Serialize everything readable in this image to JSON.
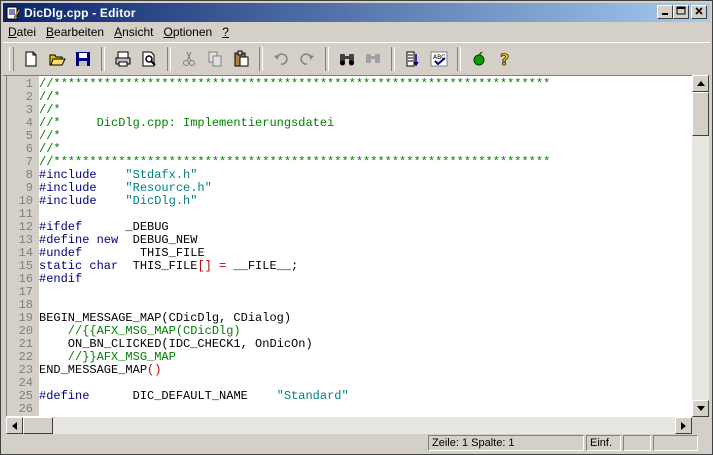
{
  "window": {
    "title": "DicDlg.cpp - Editor",
    "title_gradient": [
      "#0a246a",
      "#a6caf0"
    ],
    "controls": [
      "minimize",
      "maximize",
      "close"
    ]
  },
  "menu": [
    {
      "label": "Datei"
    },
    {
      "label": "Bearbeiten"
    },
    {
      "label": "Ansicht"
    },
    {
      "label": "Optionen"
    },
    {
      "label": "?"
    }
  ],
  "toolbar": [
    {
      "name": "new-file-icon",
      "enabled": true
    },
    {
      "name": "open-folder-icon",
      "enabled": true
    },
    {
      "name": "save-icon",
      "enabled": true
    },
    {
      "sep": true
    },
    {
      "name": "print-icon",
      "enabled": true
    },
    {
      "name": "print-preview-icon",
      "enabled": true
    },
    {
      "sep": true
    },
    {
      "name": "cut-icon",
      "enabled": false
    },
    {
      "name": "copy-icon",
      "enabled": false
    },
    {
      "name": "paste-icon",
      "enabled": true
    },
    {
      "sep": true
    },
    {
      "name": "undo-icon",
      "enabled": false
    },
    {
      "name": "redo-icon",
      "enabled": false
    },
    {
      "sep": true
    },
    {
      "name": "find-icon",
      "enabled": true
    },
    {
      "name": "replace-icon",
      "enabled": false
    },
    {
      "sep": true
    },
    {
      "name": "indent-icon",
      "enabled": true
    },
    {
      "name": "spellcheck-icon",
      "enabled": true
    },
    {
      "sep": true
    },
    {
      "name": "run-icon",
      "enabled": true
    },
    {
      "name": "help-icon",
      "enabled": true
    }
  ],
  "editor": {
    "lines": [
      {
        "n": "1",
        "segs": [
          [
            "g",
            "//*********************************************************************"
          ]
        ]
      },
      {
        "n": "2",
        "segs": [
          [
            "g",
            "//*"
          ]
        ]
      },
      {
        "n": "3",
        "segs": [
          [
            "g",
            "//*"
          ]
        ]
      },
      {
        "n": "4",
        "segs": [
          [
            "g",
            "//*     DicDlg.cpp: Implementierungsdatei"
          ]
        ]
      },
      {
        "n": "5",
        "segs": [
          [
            "g",
            "//*"
          ]
        ]
      },
      {
        "n": "6",
        "segs": [
          [
            "g",
            "//*"
          ]
        ]
      },
      {
        "n": "7",
        "segs": [
          [
            "g",
            "//*********************************************************************"
          ]
        ]
      },
      {
        "n": "8",
        "segs": [
          [
            "b",
            "#include"
          ],
          [
            "k",
            "    "
          ],
          [
            "t",
            "\"Stdafx.h\""
          ]
        ]
      },
      {
        "n": "9",
        "segs": [
          [
            "b",
            "#include"
          ],
          [
            "k",
            "    "
          ],
          [
            "t",
            "\"Resource.h\""
          ]
        ]
      },
      {
        "n": "10",
        "segs": [
          [
            "b",
            "#include"
          ],
          [
            "k",
            "    "
          ],
          [
            "t",
            "\"DicDlg.h\""
          ]
        ]
      },
      {
        "n": "11",
        "segs": [
          [
            "k",
            ""
          ]
        ]
      },
      {
        "n": "12",
        "segs": [
          [
            "b",
            "#ifdef"
          ],
          [
            "k",
            "      _DEBUG"
          ]
        ]
      },
      {
        "n": "13",
        "segs": [
          [
            "b",
            "#define new"
          ],
          [
            "k",
            "  DEBUG_NEW"
          ]
        ]
      },
      {
        "n": "14",
        "segs": [
          [
            "b",
            "#undef"
          ],
          [
            "k",
            "        THIS_FILE"
          ]
        ]
      },
      {
        "n": "15",
        "segs": [
          [
            "b",
            "static char"
          ],
          [
            "k",
            "  THIS_FILE"
          ],
          [
            "r",
            "[]"
          ],
          [
            "k",
            " "
          ],
          [
            "r",
            "="
          ],
          [
            "k",
            " __FILE__;"
          ]
        ]
      },
      {
        "n": "16",
        "segs": [
          [
            "b",
            "#endif"
          ]
        ]
      },
      {
        "n": "17",
        "segs": [
          [
            "k",
            ""
          ]
        ]
      },
      {
        "n": "18",
        "segs": [
          [
            "k",
            ""
          ]
        ]
      },
      {
        "n": "19",
        "segs": [
          [
            "k",
            "BEGIN_MESSAGE_MAP(CDicDlg, CDialog)"
          ]
        ]
      },
      {
        "n": "20",
        "segs": [
          [
            "g",
            "    //{{AFX_MSG_MAP(CDicDlg)"
          ]
        ]
      },
      {
        "n": "21",
        "segs": [
          [
            "k",
            "    ON_BN_CLICKED(IDC_CHECK1, OnDicOn)"
          ]
        ]
      },
      {
        "n": "22",
        "segs": [
          [
            "g",
            "    //}}AFX_MSG_MAP"
          ]
        ]
      },
      {
        "n": "23",
        "segs": [
          [
            "k",
            "END_MESSAGE_MAP"
          ],
          [
            "r",
            "()"
          ]
        ]
      },
      {
        "n": "24",
        "segs": [
          [
            "k",
            ""
          ]
        ]
      },
      {
        "n": "25",
        "segs": [
          [
            "b",
            "#define"
          ],
          [
            "k",
            "      DIC_DEFAULT_NAME    "
          ],
          [
            "t",
            "\"Standard\""
          ]
        ]
      },
      {
        "n": "26",
        "segs": [
          [
            "k",
            ""
          ]
        ]
      }
    ]
  },
  "status": {
    "position": "Zeile: 1  Spalte: 1",
    "mode": "Einf."
  }
}
